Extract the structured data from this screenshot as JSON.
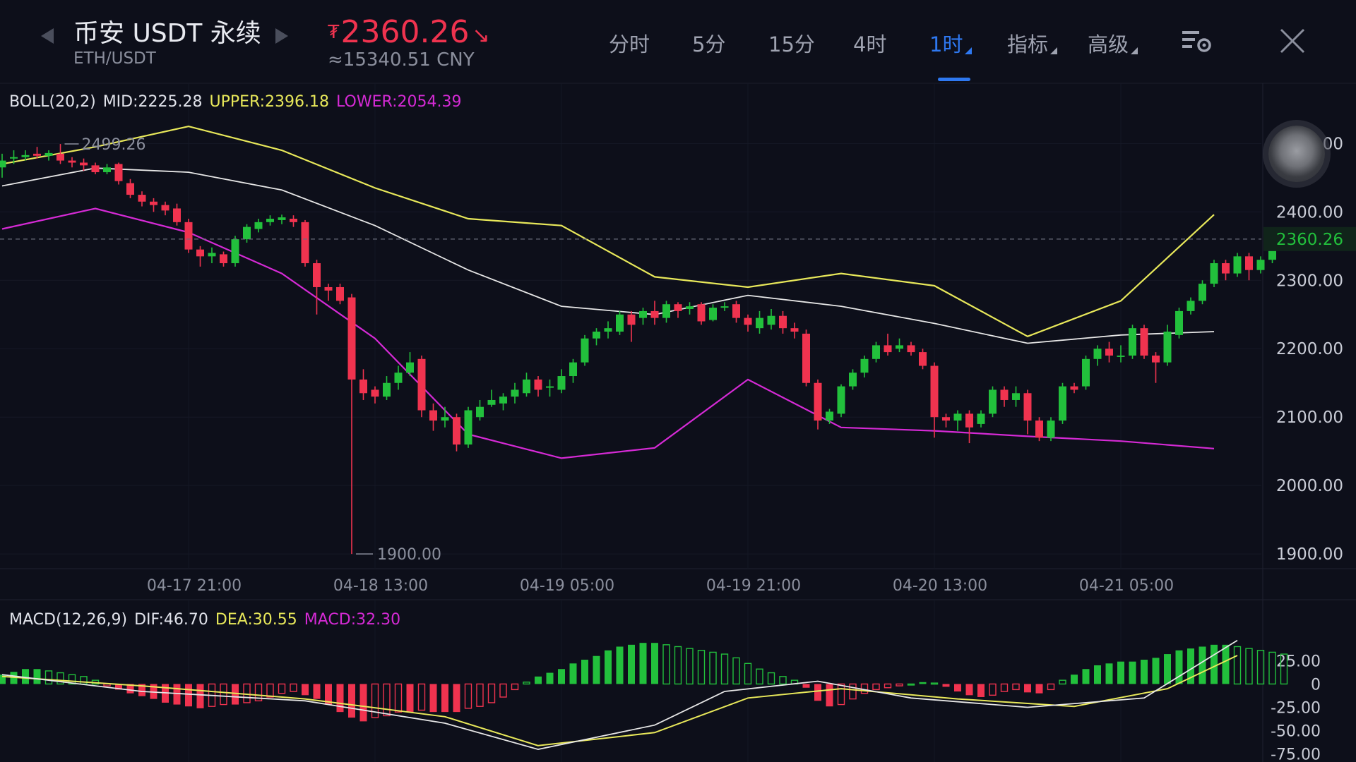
{
  "header": {
    "title": "币安 USDT 永续",
    "pair": "ETH/USDT",
    "price_symbol": "₮",
    "price": "2360.26",
    "price_direction_icon": "arrow-down-right-icon",
    "cny": "≈15340.51 CNY",
    "tabs": [
      {
        "label": "分时",
        "active": false,
        "dropdown": false
      },
      {
        "label": "5分",
        "active": false,
        "dropdown": false
      },
      {
        "label": "15分",
        "active": false,
        "dropdown": false
      },
      {
        "label": "4时",
        "active": false,
        "dropdown": false
      },
      {
        "label": "1时",
        "active": true,
        "dropdown": true
      },
      {
        "label": "指标",
        "active": false,
        "dropdown": true
      },
      {
        "label": "高级",
        "active": false,
        "dropdown": true
      }
    ],
    "icons": [
      "arrow-left-icon",
      "arrow-right-icon",
      "chart-settings-icon",
      "close-icon"
    ]
  },
  "colors": {
    "background": "#0d0f1a",
    "up": "#22c03c",
    "down": "#f0334f",
    "mid": "#e6e6e6",
    "upper": "#e8e85a",
    "lower": "#d52ad5",
    "accent": "#2e78f0"
  },
  "boll_legend": {
    "name": "BOLL(20,2)",
    "mid": "MID:2225.28",
    "upper": "UPPER:2396.18",
    "lower": "LOWER:2054.39"
  },
  "macd_legend": {
    "name": "MACD(12,26,9)",
    "dif": "DIF:46.70",
    "dea": "DEA:30.55",
    "macd": "MACD:32.30"
  },
  "chart_data": [
    {
      "type": "candlestick",
      "interval": "1h",
      "last_price": 2360.26,
      "last_price_label": "2360.26",
      "high_marker": {
        "value": 2499.26,
        "label": "2499.26"
      },
      "low_marker": {
        "value": 1900.0,
        "label": "1900.00"
      },
      "ylim": [
        1895,
        2555
      ],
      "y_ticks": [
        1900,
        2000,
        2100,
        2200,
        2300,
        2400,
        2500
      ],
      "y_tick_labels": [
        "1900.00",
        "2000.00",
        "2100.00",
        "2200.00",
        "2300.00",
        "2400.00",
        "2500.00"
      ],
      "x_tick_labels": [
        "04-17 21:00",
        "04-18 13:00",
        "04-19 05:00",
        "04-19 21:00",
        "04-20 13:00",
        "04-21 05:00"
      ],
      "x_tick_index": [
        16,
        32,
        48,
        64,
        80,
        96
      ],
      "candles": [
        [
          2465,
          2475,
          2450,
          2485
        ],
        [
          2478,
          2480,
          2470,
          2490
        ],
        [
          2480,
          2483,
          2475,
          2490
        ],
        [
          2485,
          2482,
          2478,
          2495
        ],
        [
          2482,
          2486,
          2475,
          2490
        ],
        [
          2485,
          2475,
          2470,
          2499.26
        ],
        [
          2475,
          2472,
          2465,
          2480
        ],
        [
          2472,
          2468,
          2460,
          2478
        ],
        [
          2468,
          2458,
          2455,
          2472
        ],
        [
          2458,
          2465,
          2455,
          2470
        ],
        [
          2470,
          2445,
          2440,
          2472
        ],
        [
          2442,
          2425,
          2420,
          2448
        ],
        [
          2425,
          2415,
          2408,
          2430
        ],
        [
          2415,
          2410,
          2400,
          2420
        ],
        [
          2410,
          2402,
          2395,
          2415
        ],
        [
          2405,
          2385,
          2380,
          2412
        ],
        [
          2385,
          2345,
          2340,
          2390
        ],
        [
          2345,
          2335,
          2320,
          2350
        ],
        [
          2335,
          2340,
          2325,
          2348
        ],
        [
          2338,
          2325,
          2320,
          2342
        ],
        [
          2325,
          2360,
          2320,
          2365
        ],
        [
          2360,
          2378,
          2355,
          2382
        ],
        [
          2375,
          2385,
          2370,
          2390
        ],
        [
          2385,
          2390,
          2380,
          2395
        ],
        [
          2388,
          2392,
          2382,
          2396
        ],
        [
          2390,
          2385,
          2378,
          2395
        ],
        [
          2385,
          2325,
          2320,
          2388
        ],
        [
          2325,
          2290,
          2250,
          2330
        ],
        [
          2290,
          2285,
          2270,
          2295
        ],
        [
          2290,
          2270,
          2265,
          2295
        ],
        [
          2275,
          2155,
          1900,
          2280
        ],
        [
          2155,
          2135,
          2125,
          2170
        ],
        [
          2140,
          2130,
          2120,
          2145
        ],
        [
          2130,
          2150,
          2125,
          2160
        ],
        [
          2150,
          2165,
          2140,
          2175
        ],
        [
          2165,
          2180,
          2160,
          2195
        ],
        [
          2185,
          2110,
          2100,
          2190
        ],
        [
          2110,
          2095,
          2080,
          2120
        ],
        [
          2095,
          2100,
          2085,
          2115
        ],
        [
          2100,
          2060,
          2050,
          2105
        ],
        [
          2060,
          2110,
          2055,
          2115
        ],
        [
          2100,
          2115,
          2095,
          2125
        ],
        [
          2118,
          2125,
          2115,
          2140
        ],
        [
          2120,
          2130,
          2110,
          2135
        ],
        [
          2130,
          2140,
          2120,
          2150
        ],
        [
          2135,
          2155,
          2130,
          2165
        ],
        [
          2155,
          2140,
          2130,
          2160
        ],
        [
          2145,
          2145,
          2130,
          2155
        ],
        [
          2140,
          2160,
          2135,
          2170
        ],
        [
          2160,
          2180,
          2150,
          2185
        ],
        [
          2180,
          2215,
          2175,
          2220
        ],
        [
          2215,
          2225,
          2205,
          2230
        ],
        [
          2225,
          2230,
          2215,
          2240
        ],
        [
          2225,
          2250,
          2220,
          2255
        ],
        [
          2250,
          2235,
          2210,
          2255
        ],
        [
          2245,
          2255,
          2235,
          2260
        ],
        [
          2255,
          2245,
          2235,
          2270
        ],
        [
          2245,
          2265,
          2238,
          2270
        ],
        [
          2265,
          2255,
          2245,
          2268
        ],
        [
          2258,
          2262,
          2250,
          2268
        ],
        [
          2265,
          2240,
          2235,
          2268
        ],
        [
          2242,
          2260,
          2240,
          2265
        ],
        [
          2260,
          2262,
          2255,
          2268
        ],
        [
          2265,
          2245,
          2238,
          2270
        ],
        [
          2245,
          2235,
          2225,
          2250
        ],
        [
          2230,
          2245,
          2222,
          2255
        ],
        [
          2235,
          2248,
          2228,
          2258
        ],
        [
          2248,
          2230,
          2222,
          2255
        ],
        [
          2230,
          2225,
          2215,
          2238
        ],
        [
          2222,
          2150,
          2145,
          2228
        ],
        [
          2150,
          2095,
          2082,
          2155
        ],
        [
          2095,
          2108,
          2090,
          2112
        ],
        [
          2105,
          2145,
          2100,
          2148
        ],
        [
          2145,
          2165,
          2140,
          2170
        ],
        [
          2165,
          2185,
          2158,
          2190
        ],
        [
          2185,
          2205,
          2180,
          2210
        ],
        [
          2205,
          2195,
          2190,
          2222
        ],
        [
          2200,
          2205,
          2195,
          2215
        ],
        [
          2205,
          2195,
          2190,
          2210
        ],
        [
          2195,
          2175,
          2170,
          2200
        ],
        [
          2175,
          2100,
          2070,
          2180
        ],
        [
          2100,
          2095,
          2085,
          2105
        ],
        [
          2095,
          2105,
          2080,
          2110
        ],
        [
          2105,
          2085,
          2062,
          2110
        ],
        [
          2090,
          2105,
          2085,
          2110
        ],
        [
          2105,
          2140,
          2100,
          2145
        ],
        [
          2140,
          2125,
          2115,
          2145
        ],
        [
          2125,
          2135,
          2115,
          2145
        ],
        [
          2135,
          2095,
          2075,
          2140
        ],
        [
          2095,
          2070,
          2065,
          2100
        ],
        [
          2070,
          2095,
          2065,
          2100
        ],
        [
          2095,
          2145,
          2090,
          2150
        ],
        [
          2145,
          2140,
          2135,
          2150
        ],
        [
          2145,
          2185,
          2140,
          2190
        ],
        [
          2185,
          2200,
          2175,
          2205
        ],
        [
          2200,
          2190,
          2180,
          2210
        ],
        [
          2190,
          2190,
          2180,
          2205
        ],
        [
          2190,
          2230,
          2185,
          2235
        ],
        [
          2230,
          2190,
          2185,
          2235
        ],
        [
          2190,
          2180,
          2150,
          2195
        ],
        [
          2180,
          2225,
          2175,
          2235
        ],
        [
          2220,
          2255,
          2215,
          2260
        ],
        [
          2255,
          2270,
          2250,
          2275
        ],
        [
          2270,
          2295,
          2265,
          2300
        ],
        [
          2295,
          2325,
          2290,
          2330
        ],
        [
          2325,
          2310,
          2300,
          2330
        ],
        [
          2310,
          2335,
          2305,
          2340
        ],
        [
          2335,
          2315,
          2300,
          2340
        ],
        [
          2315,
          2330,
          2310,
          2335
        ],
        [
          2330,
          2360,
          2325,
          2365
        ]
      ],
      "series_mid": [
        [
          0,
          2438
        ],
        [
          8,
          2464
        ],
        [
          16,
          2458
        ],
        [
          24,
          2432
        ],
        [
          32,
          2380
        ],
        [
          40,
          2315
        ],
        [
          48,
          2262
        ],
        [
          56,
          2250
        ],
        [
          64,
          2278
        ],
        [
          72,
          2262
        ],
        [
          80,
          2237
        ],
        [
          88,
          2208
        ],
        [
          96,
          2220
        ],
        [
          104,
          2225
        ]
      ],
      "series_upper": [
        [
          0,
          2470
        ],
        [
          8,
          2495
        ],
        [
          16,
          2525
        ],
        [
          24,
          2490
        ],
        [
          32,
          2435
        ],
        [
          40,
          2390
        ],
        [
          48,
          2380
        ],
        [
          56,
          2305
        ],
        [
          64,
          2290
        ],
        [
          72,
          2310
        ],
        [
          80,
          2292
        ],
        [
          88,
          2218
        ],
        [
          96,
          2270
        ],
        [
          104,
          2396
        ]
      ],
      "series_lower": [
        [
          0,
          2375
        ],
        [
          8,
          2405
        ],
        [
          16,
          2370
        ],
        [
          24,
          2310
        ],
        [
          32,
          2215
        ],
        [
          40,
          2075
        ],
        [
          48,
          2040
        ],
        [
          56,
          2055
        ],
        [
          64,
          2155
        ],
        [
          72,
          2085
        ],
        [
          80,
          2080
        ],
        [
          88,
          2072
        ],
        [
          96,
          2065
        ],
        [
          104,
          2054
        ]
      ]
    },
    {
      "type": "bar+line",
      "name": "MACD",
      "ylim": [
        -82,
        60
      ],
      "y_ticks": [
        25,
        0,
        -25,
        -50,
        -75
      ],
      "y_tick_labels": [
        "25.00",
        "0",
        "-25.00",
        "-50.00",
        "-75.00"
      ],
      "histogram": [
        10,
        13,
        16,
        16,
        14,
        12,
        10,
        8,
        4,
        -2,
        -6,
        -10,
        -13,
        -16,
        -20,
        -22,
        -24,
        -26,
        -24,
        -22,
        -22,
        -20,
        -18,
        -14,
        -10,
        -8,
        -12,
        -16,
        -22,
        -30,
        -36,
        -40,
        -36,
        -34,
        -30,
        -30,
        -28,
        -30,
        -30,
        -30,
        -26,
        -24,
        -20,
        -14,
        -6,
        2,
        8,
        12,
        16,
        22,
        26,
        30,
        36,
        40,
        42,
        44,
        44,
        42,
        40,
        38,
        36,
        34,
        32,
        28,
        22,
        16,
        12,
        8,
        4,
        -4,
        -18,
        -24,
        -22,
        -16,
        -10,
        -6,
        -4,
        -2,
        0,
        2,
        1,
        -3,
        -8,
        -12,
        -14,
        -12,
        -8,
        -6,
        -9,
        -10,
        -6,
        4,
        10,
        16,
        20,
        22,
        24,
        24,
        26,
        28,
        32,
        36,
        38,
        40,
        42,
        42,
        40,
        38,
        36,
        34,
        32
      ],
      "series_dif": [
        [
          0,
          10
        ],
        [
          12,
          -8
        ],
        [
          26,
          -18
        ],
        [
          38,
          -42
        ],
        [
          46,
          -70
        ],
        [
          56,
          -44
        ],
        [
          62,
          -8
        ],
        [
          70,
          3
        ],
        [
          78,
          -15
        ],
        [
          88,
          -25
        ],
        [
          98,
          -15
        ],
        [
          106,
          46.7
        ]
      ],
      "series_dea": [
        [
          0,
          8
        ],
        [
          12,
          -2
        ],
        [
          26,
          -16
        ],
        [
          38,
          -35
        ],
        [
          46,
          -66
        ],
        [
          56,
          -52
        ],
        [
          64,
          -15
        ],
        [
          72,
          -5
        ],
        [
          82,
          -16
        ],
        [
          92,
          -24
        ],
        [
          100,
          -5
        ],
        [
          106,
          30.55
        ]
      ]
    }
  ]
}
